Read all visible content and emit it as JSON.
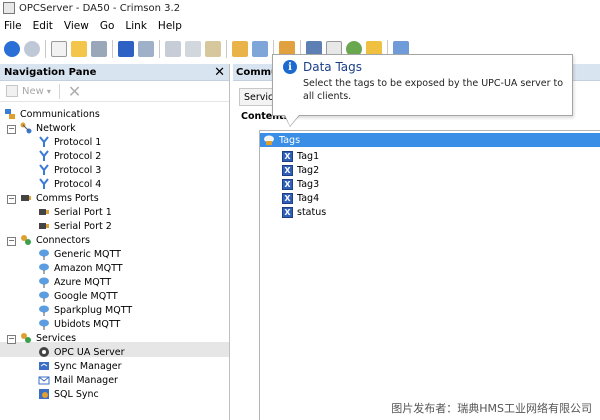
{
  "window": {
    "title": "OPCServer - DA50 - Crimson 3.2"
  },
  "menu": [
    "File",
    "Edit",
    "View",
    "Go",
    "Link",
    "Help"
  ],
  "toolbar": {
    "icons": [
      "back-icon",
      "forward-icon",
      "new-icon",
      "open-icon",
      "save-icon",
      "undo-icon",
      "redo-icon",
      "cut-icon",
      "copy-icon",
      "paste-icon",
      "spell-icon",
      "find-icon",
      "settings-icon",
      "monitor-icon",
      "export-icon",
      "globe-icon",
      "upload-icon",
      "link-icon"
    ]
  },
  "nav": {
    "title": "Navigation Pane",
    "new_label": "New",
    "tree": [
      {
        "label": "Communications",
        "icon": "communications-icon"
      },
      {
        "label": "Network",
        "icon": "network-icon"
      },
      {
        "label": "Protocol 1",
        "icon": "protocol-icon"
      },
      {
        "label": "Protocol 2",
        "icon": "protocol-icon"
      },
      {
        "label": "Protocol 3",
        "icon": "protocol-icon"
      },
      {
        "label": "Protocol 4",
        "icon": "protocol-icon"
      },
      {
        "label": "Comms Ports",
        "icon": "comms-ports-icon"
      },
      {
        "label": "Serial Port 1",
        "icon": "serial-port-icon"
      },
      {
        "label": "Serial Port 2",
        "icon": "serial-port-icon"
      },
      {
        "label": "Connectors",
        "icon": "connectors-icon"
      },
      {
        "label": "Generic MQTT",
        "icon": "cloud-icon"
      },
      {
        "label": "Amazon MQTT",
        "icon": "cloud-icon"
      },
      {
        "label": "Azure MQTT",
        "icon": "cloud-icon"
      },
      {
        "label": "Google MQTT",
        "icon": "cloud-icon"
      },
      {
        "label": "Sparkplug MQTT",
        "icon": "cloud-icon"
      },
      {
        "label": "Ubidots MQTT",
        "icon": "cloud-icon"
      },
      {
        "label": "Services",
        "icon": "services-icon"
      },
      {
        "label": "OPC UA Server",
        "icon": "opc-ua-icon"
      },
      {
        "label": "Sync Manager",
        "icon": "sync-icon"
      },
      {
        "label": "Mail Manager",
        "icon": "mail-icon"
      },
      {
        "label": "SQL Sync",
        "icon": "sql-sync-icon"
      }
    ]
  },
  "right": {
    "header": "Communi",
    "tab": "Service",
    "contents_label": "Contents",
    "tags_root": "Tags",
    "tags": [
      "Tag1",
      "Tag2",
      "Tag3",
      "Tag4",
      "status"
    ]
  },
  "tooltip": {
    "title": "Data Tags",
    "body": "Select the tags to be exposed by the UPC-UA server to all clients."
  },
  "watermark": "图片发布者：瑞典HMS工业网络有限公司",
  "colors": {
    "nav_header": "#d9e4f1",
    "selection": "#3a8ee6",
    "tooltip_title": "#1b3f87"
  }
}
